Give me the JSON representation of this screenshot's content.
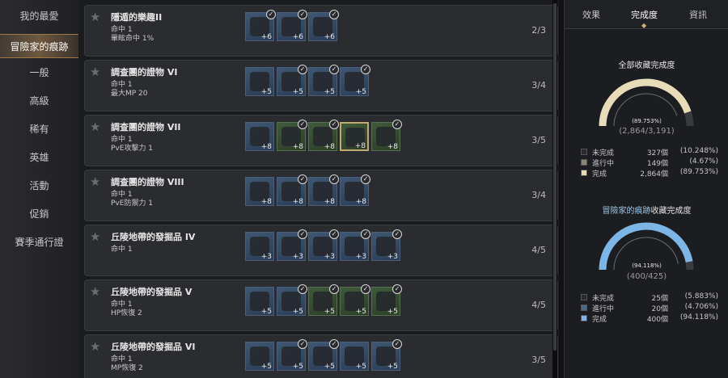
{
  "sidebar": {
    "items": [
      {
        "label": "我的最愛",
        "active": false
      },
      {
        "label": "冒險家的痕跡",
        "active": true
      },
      {
        "label": "一般",
        "active": false
      },
      {
        "label": "高級",
        "active": false
      },
      {
        "label": "稀有",
        "active": false
      },
      {
        "label": "英雄",
        "active": false
      },
      {
        "label": "活動",
        "active": false
      },
      {
        "label": "促銷",
        "active": false
      },
      {
        "label": "賽季通行證",
        "active": false
      }
    ]
  },
  "rows": [
    {
      "title": "隱遁的樂趣II",
      "stats": [
        "命中 1",
        "暈眩命中 1%"
      ],
      "count": "2/3",
      "items": [
        {
          "plus": "+6",
          "check": true,
          "color": "blue"
        },
        {
          "plus": "+6",
          "check": true,
          "color": "blue"
        },
        {
          "plus": "+6",
          "check": true,
          "color": "blue"
        }
      ]
    },
    {
      "title": "調查團的證物 VI",
      "stats": [
        "命中 1",
        "最大MP 20"
      ],
      "count": "3/4",
      "items": [
        {
          "plus": "+5",
          "check": false,
          "color": "blue"
        },
        {
          "plus": "+5",
          "check": true,
          "color": "blue"
        },
        {
          "plus": "+5",
          "check": true,
          "color": "blue"
        },
        {
          "plus": "+5",
          "check": true,
          "color": "blue"
        }
      ]
    },
    {
      "title": "調查團的證物 VII",
      "stats": [
        "命中 1",
        "PvE攻擊力 1"
      ],
      "count": "3/5",
      "items": [
        {
          "plus": "+8",
          "check": false,
          "color": "blue"
        },
        {
          "plus": "+8",
          "check": true,
          "color": "green"
        },
        {
          "plus": "+8",
          "check": true,
          "color": "green"
        },
        {
          "plus": "+8",
          "check": false,
          "color": "green",
          "selected": true
        },
        {
          "plus": "+8",
          "check": true,
          "color": "green"
        }
      ]
    },
    {
      "title": "調查團的證物 VIII",
      "stats": [
        "命中 1",
        "PvE防禦力 1"
      ],
      "count": "3/4",
      "items": [
        {
          "plus": "+8",
          "check": false,
          "color": "blue"
        },
        {
          "plus": "+8",
          "check": true,
          "color": "blue"
        },
        {
          "plus": "+8",
          "check": true,
          "color": "blue"
        },
        {
          "plus": "+8",
          "check": true,
          "color": "blue"
        }
      ]
    },
    {
      "title": "丘陵地帶的發掘品 IV",
      "stats": [
        "命中 1"
      ],
      "count": "4/5",
      "items": [
        {
          "plus": "+3",
          "check": false,
          "color": "blue"
        },
        {
          "plus": "+3",
          "check": true,
          "color": "blue"
        },
        {
          "plus": "+3",
          "check": true,
          "color": "blue"
        },
        {
          "plus": "+3",
          "check": true,
          "color": "blue"
        },
        {
          "plus": "+3",
          "check": true,
          "color": "blue"
        }
      ]
    },
    {
      "title": "丘陵地帶的發掘品 V",
      "stats": [
        "命中 1",
        "HP恢復 2"
      ],
      "count": "4/5",
      "items": [
        {
          "plus": "+5",
          "check": false,
          "color": "blue"
        },
        {
          "plus": "+5",
          "check": true,
          "color": "blue"
        },
        {
          "plus": "+5",
          "check": true,
          "color": "green"
        },
        {
          "plus": "+5",
          "check": true,
          "color": "green"
        },
        {
          "plus": "+5",
          "check": true,
          "color": "green"
        }
      ]
    },
    {
      "title": "丘陵地帶的發掘品 VI",
      "stats": [
        "命中 1",
        "MP恢復 2"
      ],
      "count": "3/5",
      "items": [
        {
          "plus": "+5",
          "check": false,
          "color": "blue"
        },
        {
          "plus": "+5",
          "check": true,
          "color": "blue"
        },
        {
          "plus": "+5",
          "check": true,
          "color": "blue"
        },
        {
          "plus": "+5",
          "check": false,
          "color": "blue"
        },
        {
          "plus": "+5",
          "check": true,
          "color": "blue"
        }
      ]
    }
  ],
  "panel": {
    "tabs": [
      {
        "label": "效果"
      },
      {
        "label": "完成度",
        "active": true
      },
      {
        "label": "資訊"
      }
    ],
    "overall": {
      "title": "全部收藏完成度",
      "percent_label": "(89.753%)",
      "total_label": "(2,864/3,191)",
      "fraction": 0.89753,
      "accent_color": "#e8dcb8",
      "legend": [
        {
          "name": "未完成",
          "num": "327個",
          "pct": "(10.248%)",
          "color": "#2a2b2f"
        },
        {
          "name": "進行中",
          "num": "149個",
          "pct": "(4.67%)",
          "color": "#8a8478"
        },
        {
          "name": "完成",
          "num": "2,864個",
          "pct": "(89.753%)",
          "color": "#e8dcb8"
        }
      ]
    },
    "category": {
      "title_accent": "冒險家的痕跡",
      "title_rest": "收藏完成度",
      "percent_label": "(94.118%)",
      "total_label": "(400/425)",
      "fraction": 0.94118,
      "accent_color": "#7cb6e6",
      "legend": [
        {
          "name": "未完成",
          "num": "25個",
          "pct": "(5.883%)",
          "color": "#2a2b2f"
        },
        {
          "name": "進行中",
          "num": "20個",
          "pct": "(4.706%)",
          "color": "#4a6a8a"
        },
        {
          "name": "完成",
          "num": "400個",
          "pct": "(94.118%)",
          "color": "#7cb6e6"
        }
      ]
    }
  }
}
